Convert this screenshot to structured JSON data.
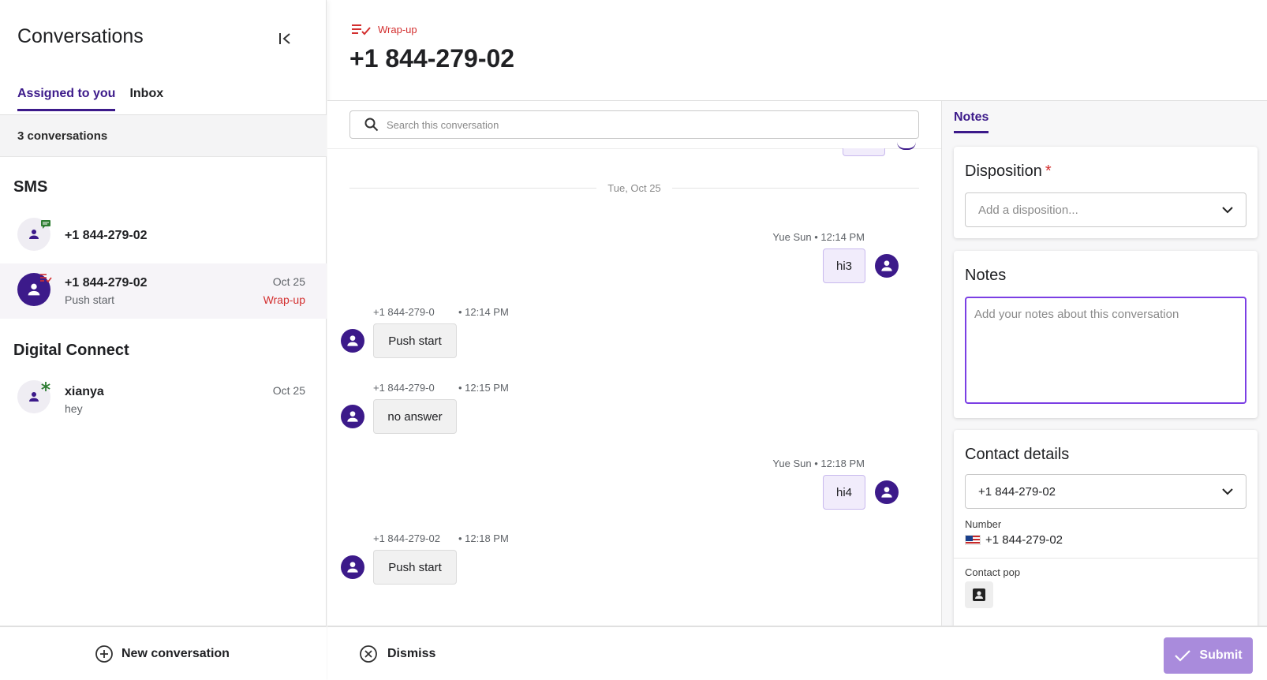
{
  "sidebar": {
    "title": "Conversations",
    "tabs": [
      {
        "label": "Assigned to you",
        "active": true
      },
      {
        "label": "Inbox",
        "active": false
      }
    ],
    "count_label": "3 conversations",
    "sections": [
      {
        "title": "SMS",
        "items": [
          {
            "name": "+1 844-279-02",
            "subtitle": "",
            "date": "",
            "status": "",
            "badge": "chat-icon"
          },
          {
            "name": "+1 844-279-02",
            "subtitle": "Push start",
            "date": "Oct 25",
            "status": "Wrap-up",
            "badge": "wrap-up-icon",
            "selected": true
          }
        ]
      },
      {
        "title": "Digital Connect",
        "items": [
          {
            "name": "xianya",
            "subtitle": "hey",
            "date": "Oct 25",
            "status": "",
            "badge": "asterisk-icon"
          }
        ]
      }
    ],
    "new_conversation_label": "New conversation"
  },
  "header": {
    "status": "Wrap-up",
    "title": "+1 844-279-02"
  },
  "conversation": {
    "search_placeholder": "Search this conversation",
    "date_separator": "Tue, Oct 25",
    "messages": [
      {
        "direction": "out",
        "meta": "Yue Sun • 12:14 PM",
        "text": "hi3"
      },
      {
        "direction": "in",
        "sender": "+1 844-279-0",
        "time": "• 12:14 PM",
        "text": "Push start"
      },
      {
        "direction": "in",
        "sender": "+1 844-279-0",
        "time": "• 12:15 PM",
        "text": "no answer"
      },
      {
        "direction": "out",
        "meta": "Yue Sun • 12:18 PM",
        "text": "hi4"
      },
      {
        "direction": "in",
        "sender": "+1 844-279-02",
        "time": "• 12:18 PM",
        "text": "Push start"
      }
    ]
  },
  "right_panel": {
    "tab": "Notes",
    "disposition": {
      "title": "Disposition",
      "required_mark": "*",
      "placeholder": "Add a disposition..."
    },
    "notes": {
      "title": "Notes",
      "placeholder": "Add your notes about this conversation"
    },
    "contact": {
      "title": "Contact details",
      "selected": "+1 844-279-02",
      "number_label": "Number",
      "number_value": "+1 844-279-02",
      "contact_pop_label": "Contact pop"
    }
  },
  "footer": {
    "dismiss_label": "Dismiss",
    "submit_label": "Submit"
  },
  "colors": {
    "accent": "#3c1a8a",
    "wrapup_red": "#d32f2f",
    "submit_disabled": "#a98bdc",
    "outgoing_bubble": "#f1ecfb"
  }
}
